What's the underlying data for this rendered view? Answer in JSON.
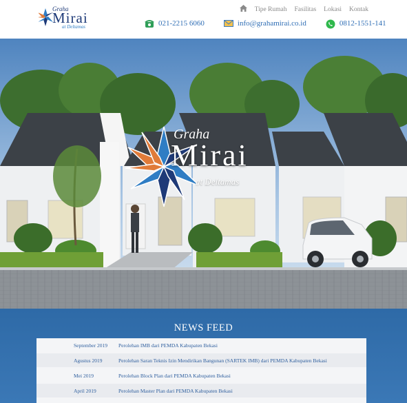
{
  "logo": {
    "graha": "Graha",
    "mirai": "Mirai",
    "at": "at Deltamas"
  },
  "nav": {
    "home_icon": "home-icon",
    "items": [
      "Tipe Rumah",
      "Fasilitas",
      "Lokasi",
      "Kontak"
    ]
  },
  "contacts": {
    "phone": {
      "icon": "phone-icon",
      "text": "021-2215 6060"
    },
    "email": {
      "icon": "envelope-icon",
      "text": "info@grahamirai.co.id"
    },
    "whatsapp": {
      "icon": "whatsapp-icon",
      "text": "0812-1551-141"
    }
  },
  "hero": {
    "graha": "Graha",
    "mirai": "Mirai",
    "at": "at Deltamas"
  },
  "news": {
    "title": "NEWS FEED",
    "items": [
      {
        "date": "September 2019",
        "text": "Perolehan IMB dari PEMDA Kabupaten Bekasi"
      },
      {
        "date": "Agustus 2019",
        "text": "Perolehan Saran Teknis Izin Mendirikan Bangunan (SARTEK IMB) dari PEMDA Kabupaten Bekasi"
      },
      {
        "date": "Mei 2019",
        "text": "Perolehan Block Plan dari PEMDA Kabupaten Bekasi"
      },
      {
        "date": "April 2019",
        "text": "Perolehan Master Plan dari PEMDA Kabupaten Bekasi"
      }
    ]
  }
}
